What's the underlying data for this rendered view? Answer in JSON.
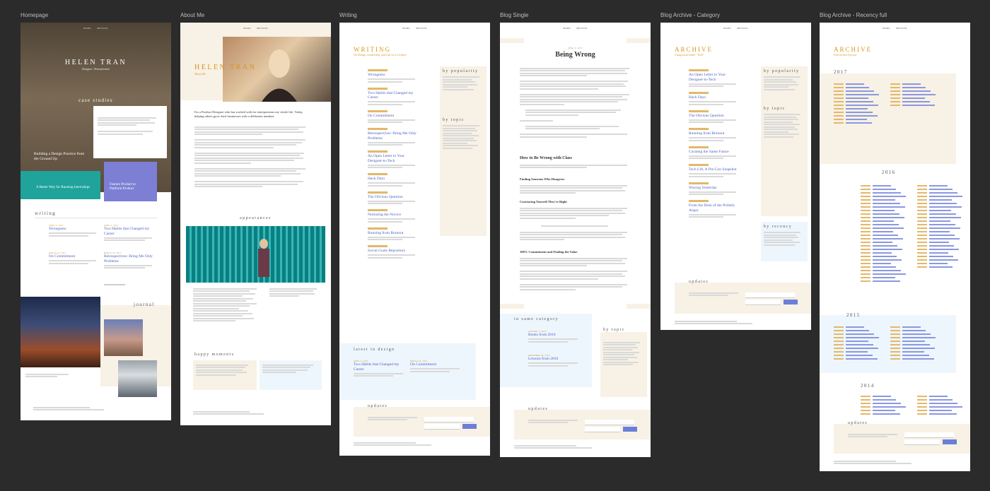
{
  "boards": {
    "home": {
      "label": "Homepage"
    },
    "about": {
      "label": "About Me"
    },
    "writing": {
      "label": "Writing"
    },
    "single": {
      "label": "Blog Single"
    },
    "category": {
      "label": "Blog Archive - Category"
    },
    "recency": {
      "label": "Blog Archive - Recency full"
    }
  },
  "nav": {
    "item1": "WORK",
    "item2": "WRITING"
  },
  "home": {
    "hero_name": "HELEN TRAN",
    "hero_sub": "Designer | Entrepreneur",
    "case_heading": "case studies",
    "case1_title": "Building a Design Practice from the Ground Up",
    "case2_title": "A Better Way for Running Internships",
    "case3_title": "Feature Product to Platform Product",
    "writing_heading": "writing",
    "post1": "Wrongness",
    "post2": "Two Habits that Changed my Career",
    "post3": "On Commitment",
    "post4": "Retrospectives: Bring Me Only Problems",
    "journal_heading": "journal"
  },
  "about": {
    "title": "HELEN TRAN",
    "subtitle": "About Me",
    "intro": "I'm a Product Designer who has worked with for entrepreneurs my whole life. Today, helping others grow their businesses with a deliberate mindset.",
    "appearances_heading": "appearances",
    "happy_heading": "happy moments"
  },
  "writing": {
    "title": "WRITING",
    "subtitle": "On Design, Leadership, and Life as a Creative",
    "posts": [
      "Wrongness",
      "Two Habits that Changed my Career",
      "On Commitment",
      "Retrospectives: Bring Me Only Problems",
      "An Open Letter to Your Designer-to-Tech",
      "Hack Days",
      "The Obvious Question",
      "Nurturing the Novice",
      "Running from Burnout",
      "Social Goals Repository"
    ],
    "popularity_heading": "by popularity",
    "topic_heading": "by topic",
    "latest_heading": "latest in design",
    "latest1": "Two Habits that Changed my Career",
    "latest2": "On Commitment",
    "updates_heading": "updates"
  },
  "single": {
    "title": "Being Wrong",
    "h_wrong_class": "How to Be Wrong with Class",
    "h_finding": "Finding Someone Who Disagrees",
    "h_convincing": "Convincing Yourself They're Right",
    "h_commitment": "100% Commitment and Finding the Value",
    "same_category": "in same category",
    "related1": "Books from 2016",
    "related2": "Lessons from 2016",
    "topic_heading": "by topic",
    "updates_heading": "updates"
  },
  "category": {
    "title": "ARCHIVE",
    "subtitle": "Categorized under \"Tech\"",
    "posts": [
      "An Open Letter to Your Designer-to-Tech",
      "Hack Days",
      "The Obvious Question",
      "Running from Burnout",
      "Curating the Same Future",
      "Tech Lift, A Pre-Con Snapshot",
      "Waxing Yesterday",
      "From the Desk of the Politely Angry"
    ],
    "popularity_heading": "by popularity",
    "topic_heading": "by topic",
    "recency_heading": "by recency",
    "updates_heading": "updates"
  },
  "recency": {
    "title": "ARCHIVE",
    "subtitle": "Full archive by year",
    "year1": "2017",
    "year2": "2016",
    "year3": "2015",
    "year4": "2014",
    "updates_heading": "updates"
  },
  "colors": {
    "background": "#2b2b2b",
    "accent_orange": "#d9951f",
    "accent_blue": "#5b6dd1",
    "beige": "#f8f1e5",
    "light_blue": "#eef6fd",
    "teal": "#1fa39a",
    "purple": "#7c7fd4"
  }
}
